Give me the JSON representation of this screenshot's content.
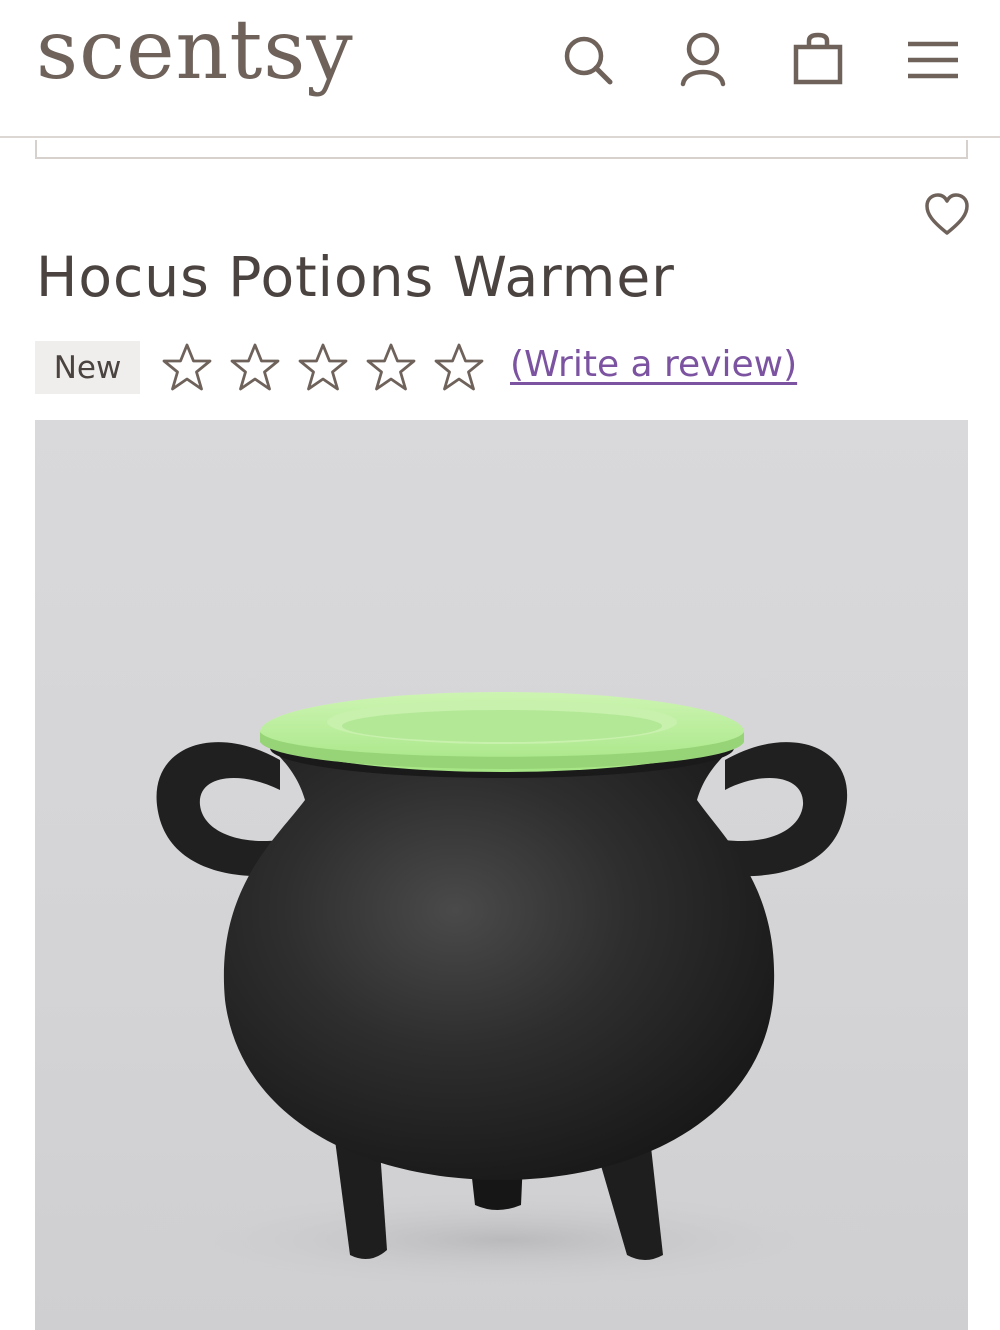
{
  "header": {
    "logo_text": "scentsy",
    "icons": [
      "search-icon",
      "account-icon",
      "shopping-bag-icon",
      "menu-icon"
    ]
  },
  "product": {
    "title": "Hocus Potions Warmer",
    "badge": "New",
    "rating": 0,
    "rating_max": 5,
    "review_link": "(Write a review)",
    "image_alt": "black cauldron warmer with green dish"
  },
  "colors": {
    "logo": "#6e625b",
    "text": "#4a4340",
    "link": "#7b53a1",
    "star_outline": "#6e625b",
    "image_bg": "#d6d6d8",
    "cauldron": "#2b2b2b",
    "dish": "#b9ee9a"
  }
}
